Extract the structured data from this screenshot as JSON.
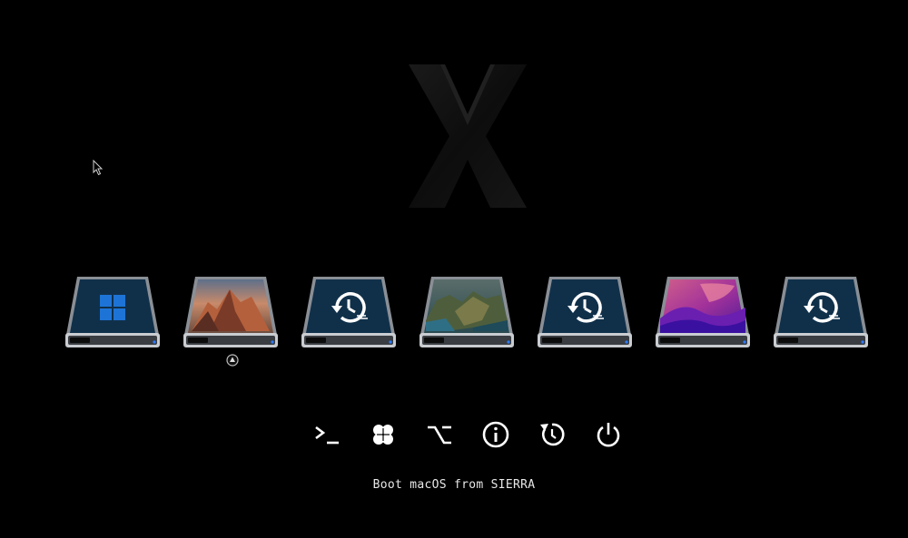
{
  "status_text": "Boot macOS from SIERRA",
  "logo_icon": "clover-x-logo",
  "cursor_icon": "mouse-pointer-icon",
  "selected_entry_index": 1,
  "boot_entries": [
    {
      "name": "windows",
      "icon": "windows-logo-icon"
    },
    {
      "name": "macos-sierra",
      "icon": "sierra-mountain-wallpaper"
    },
    {
      "name": "time-machine-recovery-1",
      "icon": "time-machine-icon"
    },
    {
      "name": "macos-big-sur",
      "icon": "big-sur-coast-wallpaper"
    },
    {
      "name": "time-machine-recovery-2",
      "icon": "time-machine-icon"
    },
    {
      "name": "macos-monterey",
      "icon": "monterey-wallpaper"
    },
    {
      "name": "time-machine-recovery-3",
      "icon": "time-machine-icon"
    }
  ],
  "tools": [
    {
      "name": "shell",
      "icon": "terminal-icon"
    },
    {
      "name": "clover-options",
      "icon": "clover-icon"
    },
    {
      "name": "options",
      "icon": "option-key-icon"
    },
    {
      "name": "about",
      "icon": "info-icon"
    },
    {
      "name": "restart",
      "icon": "restart-icon"
    },
    {
      "name": "shutdown",
      "icon": "power-icon"
    }
  ],
  "colors": {
    "background": "#000000",
    "drive_screen": "#0f3552",
    "accent_dot": "#2f7bff",
    "icon_white": "#ffffff"
  }
}
